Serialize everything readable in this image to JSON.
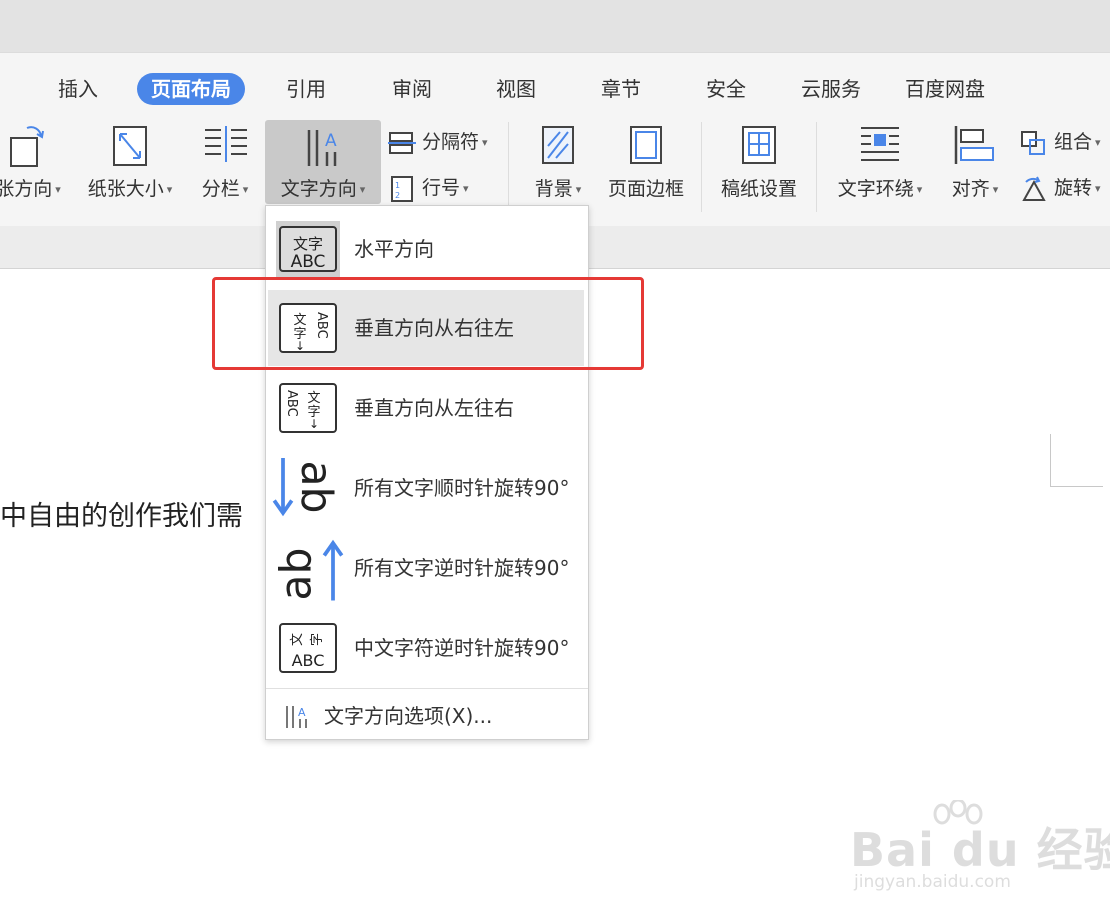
{
  "tabs": [
    {
      "label": "插入",
      "active": false
    },
    {
      "label": "页面布局",
      "active": true
    },
    {
      "label": "引用",
      "active": false
    },
    {
      "label": "审阅",
      "active": false
    },
    {
      "label": "视图",
      "active": false
    },
    {
      "label": "章节",
      "active": false
    },
    {
      "label": "安全",
      "active": false
    },
    {
      "label": "云服务",
      "active": false
    },
    {
      "label": "百度网盘",
      "active": false
    }
  ],
  "ribbon": {
    "orientation_label": "张方向",
    "paper_size_label": "纸张大小",
    "columns_label": "分栏",
    "text_direction_label": "文字方向",
    "separator_label": "分隔符",
    "line_number_label": "行号",
    "background_label": "背景",
    "page_border_label": "页面边框",
    "manuscript_label": "稿纸设置",
    "text_wrap_label": "文字环绕",
    "align_label": "对齐",
    "group_label": "组合",
    "rotate_label": "旋转"
  },
  "menu": {
    "items": [
      {
        "label": "水平方向",
        "icon": "horizontal-text-icon"
      },
      {
        "label": "垂直方向从右往左",
        "icon": "vertical-rtl-icon"
      },
      {
        "label": "垂直方向从左往右",
        "icon": "vertical-ltr-icon"
      },
      {
        "label": "所有文字顺时针旋转90°",
        "icon": "rotate-cw-icon"
      },
      {
        "label": "所有文字逆时针旋转90°",
        "icon": "rotate-ccw-icon"
      },
      {
        "label": "中文字符逆时针旋转90°",
        "icon": "chinese-rotate-icon"
      }
    ],
    "options_label": "文字方向选项(X)..."
  },
  "icon_text": {
    "wen_zi": "文字",
    "abc": "ABC",
    "ab": "ab"
  },
  "document": {
    "text": "中自由的创作我们需"
  },
  "watermark": {
    "brand": "Bai du 经验",
    "url": "jingyan.baidu.com"
  },
  "colors": {
    "accent": "#4a86e8",
    "highlight_box": "#e53935",
    "arrow_blue": "#4a86e8"
  }
}
